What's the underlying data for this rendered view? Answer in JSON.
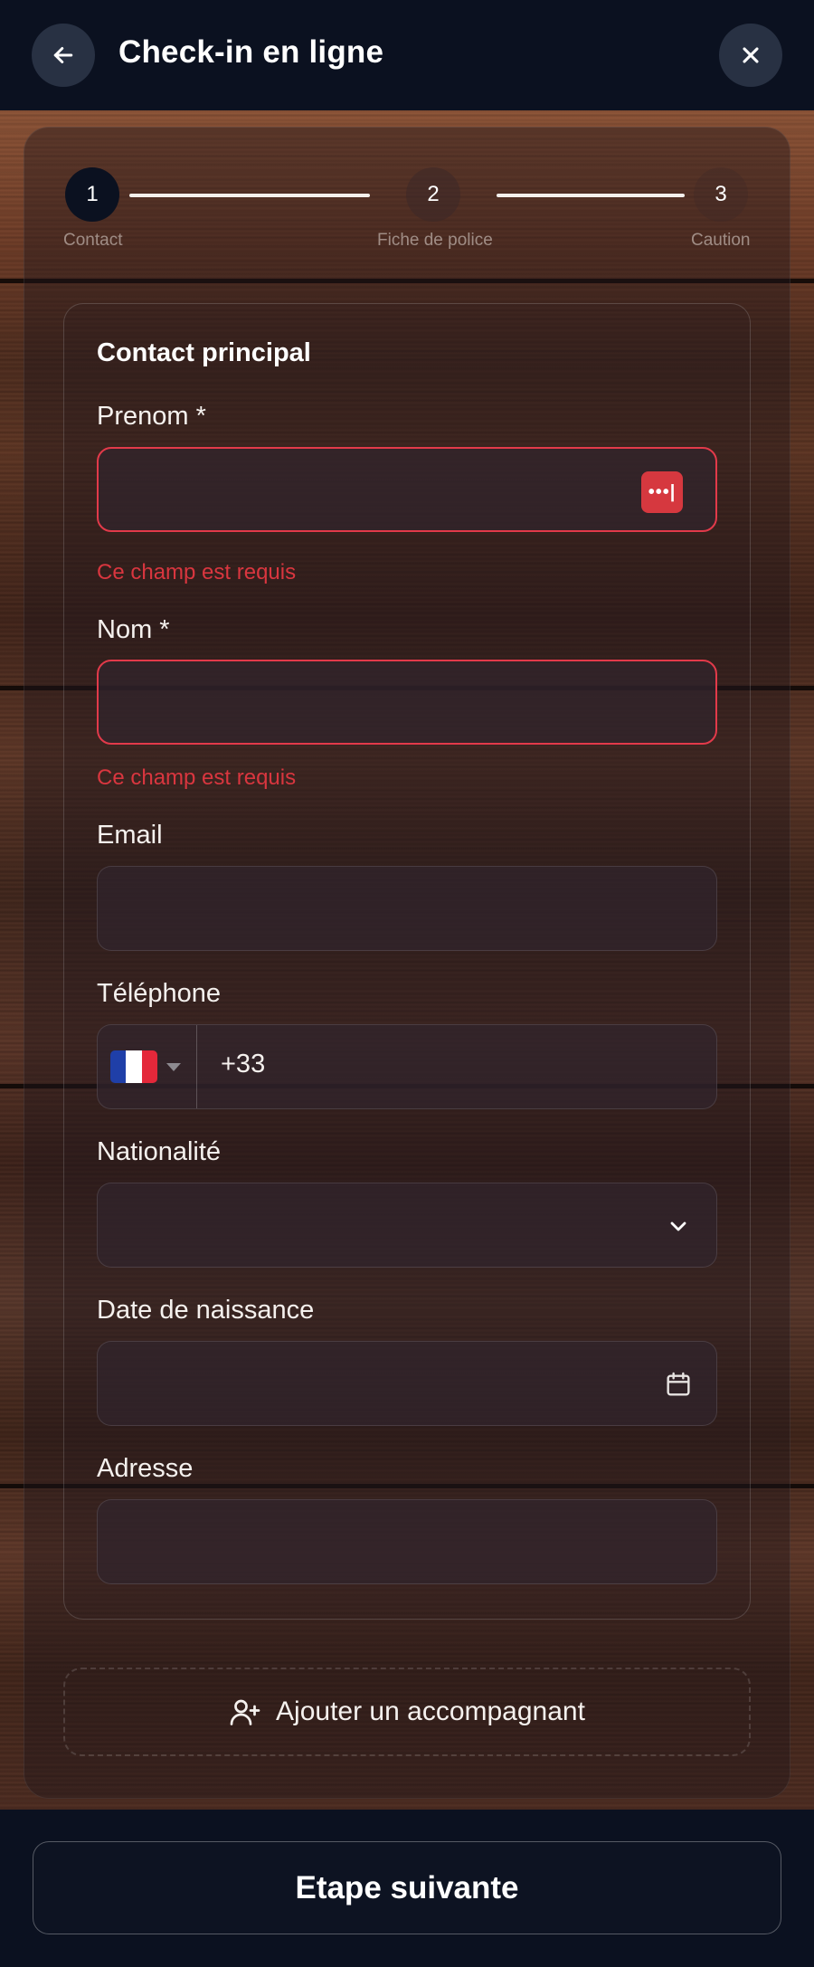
{
  "header": {
    "title": "Check-in en ligne",
    "back_icon": "arrow-left-icon",
    "close_icon": "close-icon"
  },
  "stepper": {
    "steps": [
      {
        "number": "1",
        "label": "Contact",
        "active": true
      },
      {
        "number": "2",
        "label": "Fiche de police",
        "active": false
      },
      {
        "number": "3",
        "label": "Caution",
        "active": false
      }
    ]
  },
  "form": {
    "section_title": "Contact principal",
    "prenom": {
      "label": "Prenom *",
      "value": "",
      "error": "Ce champ est requis"
    },
    "nom": {
      "label": "Nom *",
      "value": "",
      "error": "Ce champ est requis"
    },
    "email": {
      "label": "Email",
      "value": ""
    },
    "telephone": {
      "label": "Téléphone",
      "country": "FR",
      "prefix": "+33"
    },
    "nationalite": {
      "label": "Nationalité",
      "value": ""
    },
    "date_naissance": {
      "label": "Date de naissance",
      "value": ""
    },
    "adresse": {
      "label": "Adresse",
      "value": ""
    }
  },
  "add_companion": {
    "label": "Ajouter un accompagnant"
  },
  "footer": {
    "next_label": "Etape suivante"
  },
  "colors": {
    "background": "#0b1120",
    "error": "#e23a4a",
    "password_manager": "#d6383f",
    "text": "#f5f1ee"
  }
}
